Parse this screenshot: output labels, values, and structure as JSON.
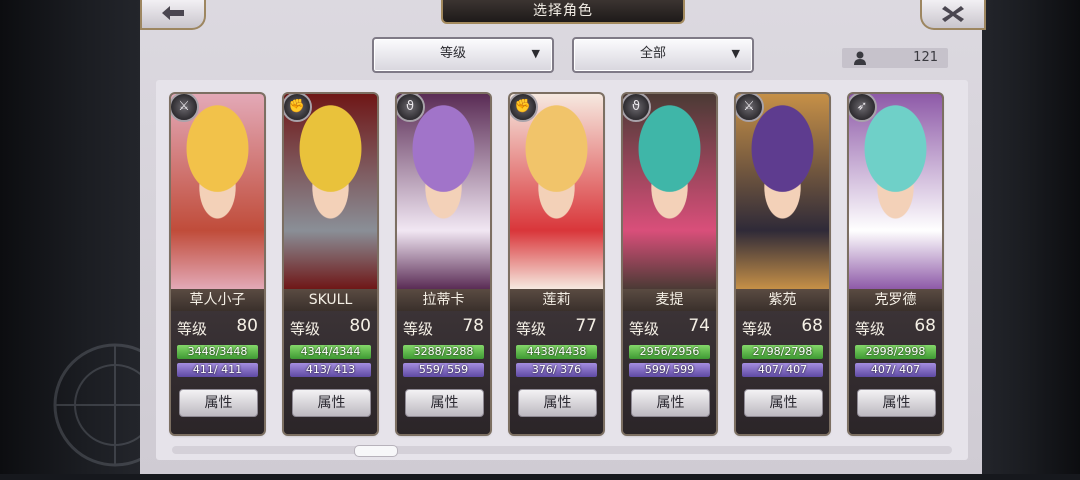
{
  "header": {
    "title": "选择角色"
  },
  "filters": {
    "level_label": "等级",
    "filter_label": "全部",
    "arrow": "▼"
  },
  "count": {
    "value": "121",
    "icon": "user-icon"
  },
  "icons": {
    "back": "back-arrow-icon",
    "close": "close-x-icon"
  },
  "characters": [
    {
      "name": "草人小子",
      "level_label": "等级",
      "level": "80",
      "hp": "3448/3448",
      "sp": "411/ 411",
      "attr_label": "属性",
      "job_icon": "sword-shield-icon",
      "job_glyph": "⚔",
      "colors": [
        "#f2c24a",
        "#c04c3a",
        "#e3a9b7"
      ]
    },
    {
      "name": "SKULL",
      "level_label": "等级",
      "level": "80",
      "hp": "4344/4344",
      "sp": "413/ 413",
      "attr_label": "属性",
      "job_icon": "gauntlet-icon",
      "job_glyph": "✊",
      "colors": [
        "#e9c23b",
        "#8a8f97",
        "#6f1717"
      ]
    },
    {
      "name": "拉蒂卡",
      "level_label": "等级",
      "level": "78",
      "hp": "3288/3288",
      "sp": "559/ 559",
      "attr_label": "属性",
      "job_icon": "staff-icon",
      "job_glyph": "ϑ",
      "colors": [
        "#a174c9",
        "#f1e7f3",
        "#5a2c55"
      ]
    },
    {
      "name": "莲莉",
      "level_label": "等级",
      "level": "77",
      "hp": "4438/4438",
      "sp": "376/ 376",
      "attr_label": "属性",
      "job_icon": "gauntlet-icon",
      "job_glyph": "✊",
      "colors": [
        "#f1c46a",
        "#d9363a",
        "#f6e9e0"
      ]
    },
    {
      "name": "麦提",
      "level_label": "等级",
      "level": "74",
      "hp": "2956/2956",
      "sp": "599/ 599",
      "attr_label": "属性",
      "job_icon": "staff-icon",
      "job_glyph": "ϑ",
      "colors": [
        "#3fb6a8",
        "#d94f7a",
        "#4b3a35"
      ]
    },
    {
      "name": "紫苑",
      "level_label": "等级",
      "level": "68",
      "hp": "2798/2798",
      "sp": "407/ 407",
      "attr_label": "属性",
      "job_icon": "sword-icon",
      "job_glyph": "⚔",
      "colors": [
        "#5e3c8f",
        "#2f2a38",
        "#c69047"
      ]
    },
    {
      "name": "克罗德",
      "level_label": "等级",
      "level": "68",
      "hp": "2998/2998",
      "sp": "407/ 407",
      "attr_label": "属性",
      "job_icon": "bow-icon",
      "job_glyph": "➶",
      "colors": [
        "#6fd0c8",
        "#ffffff",
        "#8e5aa8"
      ]
    }
  ]
}
